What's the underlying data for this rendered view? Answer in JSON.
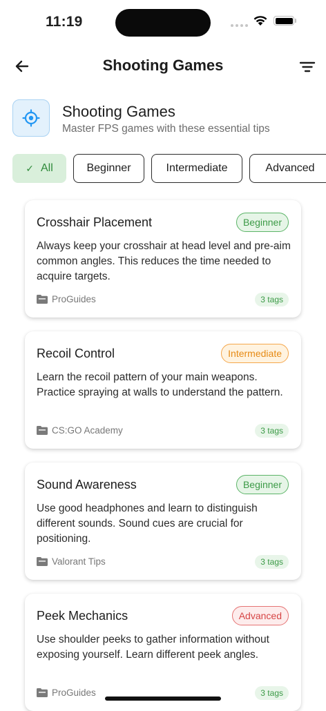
{
  "status_bar": {
    "time": "11:19"
  },
  "app_bar": {
    "title": "Shooting Games"
  },
  "category": {
    "title": "Shooting Games",
    "subtitle": "Master FPS games with these essential tips",
    "icon": "crosshair-icon",
    "accent": "#2196F3"
  },
  "filters": {
    "chips": [
      {
        "label": "All",
        "selected": true
      },
      {
        "label": "Beginner",
        "selected": false
      },
      {
        "label": "Intermediate",
        "selected": false
      },
      {
        "label": "Advanced",
        "selected": false
      }
    ]
  },
  "tips": [
    {
      "title": "Crosshair Placement",
      "level": "Beginner",
      "description": "Always keep your crosshair at head level and pre-aim common angles. This reduces the time needed to acquire targets.",
      "source": "ProGuides",
      "tags": "3 tags"
    },
    {
      "title": "Recoil Control",
      "level": "Intermediate",
      "description": "Learn the recoil pattern of your main weapons. Practice spraying at walls to understand the pattern.",
      "source": "CS:GO Academy",
      "tags": "3 tags"
    },
    {
      "title": "Sound Awareness",
      "level": "Beginner",
      "description": "Use good headphones and learn to distinguish different sounds. Sound cues are crucial for positioning.",
      "source": "Valorant Tips",
      "tags": "3 tags"
    },
    {
      "title": "Peek Mechanics",
      "level": "Advanced",
      "description": "Use shoulder peeks to gather information without exposing yourself. Learn different peek angles.",
      "source": "ProGuides",
      "tags": "3 tags"
    }
  ],
  "colors": {
    "beginner": "#3C9A47",
    "intermediate": "#E68A14",
    "advanced": "#D64545",
    "selected_chip_bg": "#D9EFDB"
  }
}
